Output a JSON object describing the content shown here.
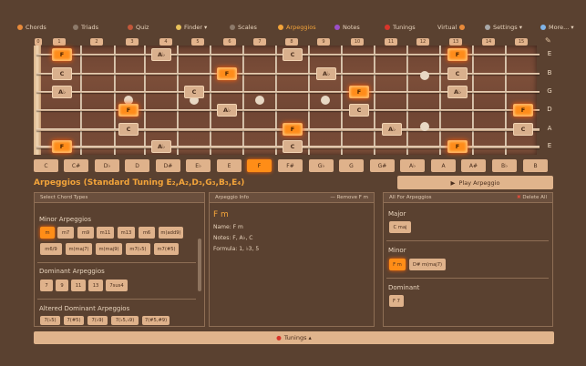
{
  "nav": {
    "items": [
      {
        "label": "Chords",
        "icon": "guitar-icon",
        "color": "#e88a3a"
      },
      {
        "label": "Triads",
        "icon": "triad-icon",
        "color": "#8d7a6a"
      },
      {
        "label": "Quiz",
        "icon": "quiz-icon",
        "color": "#c2573a"
      },
      {
        "label": "Finder ▾",
        "icon": "bulb-icon",
        "color": "#e8c15a"
      },
      {
        "label": "Scales",
        "icon": "scales-icon",
        "color": "#8d7a6a"
      },
      {
        "label": "Arpeggios",
        "icon": "arpeggio-icon",
        "color": "#f2a33a"
      },
      {
        "label": "Notes",
        "icon": "notes-icon",
        "color": "#9b4fc9"
      },
      {
        "label": "Tunings",
        "icon": "tuning-icon",
        "color": "#d8352a"
      },
      {
        "label": "Virtual",
        "icon": "virtual-guitar-icon",
        "color": "#e88a3a"
      },
      {
        "label": "Settings ▾",
        "icon": "gear-icon",
        "color": "#a8a8a8"
      },
      {
        "label": "More... ▾",
        "icon": "sparkle-icon",
        "color": "#7fb3e8"
      }
    ],
    "active": "Arpeggios"
  },
  "fret_numbers": [
    "0",
    "1",
    "2",
    "3",
    "4",
    "5",
    "6",
    "7",
    "8",
    "9",
    "10",
    "11",
    "12",
    "13",
    "14",
    "15"
  ],
  "string_names": [
    "E",
    "B",
    "G",
    "D",
    "A",
    "E"
  ],
  "keys": [
    "C",
    "C#",
    "D♭",
    "D",
    "D#",
    "E♭",
    "E",
    "F",
    "F#",
    "G♭",
    "G",
    "G#",
    "A♭",
    "A",
    "A#",
    "B♭",
    "B"
  ],
  "selected_key": "F",
  "fretboard_notes": [
    {
      "label": "F",
      "type": "root"
    },
    {
      "label": "A♭",
      "type": "note"
    },
    {
      "label": "C",
      "type": "note"
    },
    {
      "label": "F",
      "type": "root"
    },
    {
      "label": "C",
      "type": "note"
    },
    {
      "label": "F",
      "type": "root"
    },
    {
      "label": "A♭",
      "type": "note"
    },
    {
      "label": "C",
      "type": "note"
    },
    {
      "label": "A♭",
      "type": "note"
    },
    {
      "label": "C",
      "type": "note"
    },
    {
      "label": "F",
      "type": "root"
    },
    {
      "label": "A♭",
      "type": "note"
    },
    {
      "label": "F",
      "type": "root"
    },
    {
      "label": "A♭",
      "type": "note"
    },
    {
      "label": "C",
      "type": "note"
    },
    {
      "label": "F",
      "type": "root"
    },
    {
      "label": "C",
      "type": "note"
    },
    {
      "label": "F",
      "type": "root"
    },
    {
      "label": "A♭",
      "type": "note"
    },
    {
      "label": "C",
      "type": "note"
    },
    {
      "label": "F",
      "type": "root"
    },
    {
      "label": "A♭",
      "type": "note"
    },
    {
      "label": "C",
      "type": "note"
    },
    {
      "label": "F",
      "type": "root"
    }
  ],
  "title": "Arpeggios (Standard Tuning E₂,A₂,D₃,G₃,B₃,E₄)",
  "play_button": "Play Arpeggio",
  "panels": {
    "select": {
      "header": "Select Chord Types",
      "minor_title": "Minor Arpeggios",
      "minor": [
        "m",
        "m7",
        "m9",
        "m11",
        "m13",
        "m6",
        "m(add9)",
        "m6/9",
        "m(maj7)",
        "m(maj9)",
        "m7(♭5)",
        "m7(#5)"
      ],
      "minor_selected": "m",
      "dominant_title": "Dominant Arpeggios",
      "dominant": [
        "7",
        "9",
        "11",
        "13",
        "7sus4"
      ],
      "altered_title": "Altered Dominant Arpeggios",
      "altered": [
        "7(♭5)",
        "7(#5)",
        "7(♭9)",
        "7(♭5,♭9)",
        "7(#5,#9)"
      ]
    },
    "info": {
      "header": "Arpeggio Info",
      "action": "Remove F m",
      "chord": "F m",
      "name_label": "Name:",
      "name_value": "F m",
      "notes_label": "Notes:",
      "notes_value": "F, A♭, C",
      "formula_label": "Formula:",
      "formula_value": "1, ♭3, 5"
    },
    "all": {
      "header": "All For Arpeggios",
      "action": "Delete All",
      "major_title": "Major",
      "major": [
        "C maj"
      ],
      "minor_title": "Minor",
      "minor": [
        "F m",
        "D# m(maj7)"
      ],
      "minor_selected": "F m",
      "dominant_title": "Dominant",
      "dominant": [
        "F 7"
      ]
    }
  },
  "tunings_bar": "Tunings ▴",
  "colors": {
    "accent": "#f2a33a",
    "root": "#ff8c1a",
    "chip": "#dfb28b",
    "bg": "#5a4130"
  }
}
